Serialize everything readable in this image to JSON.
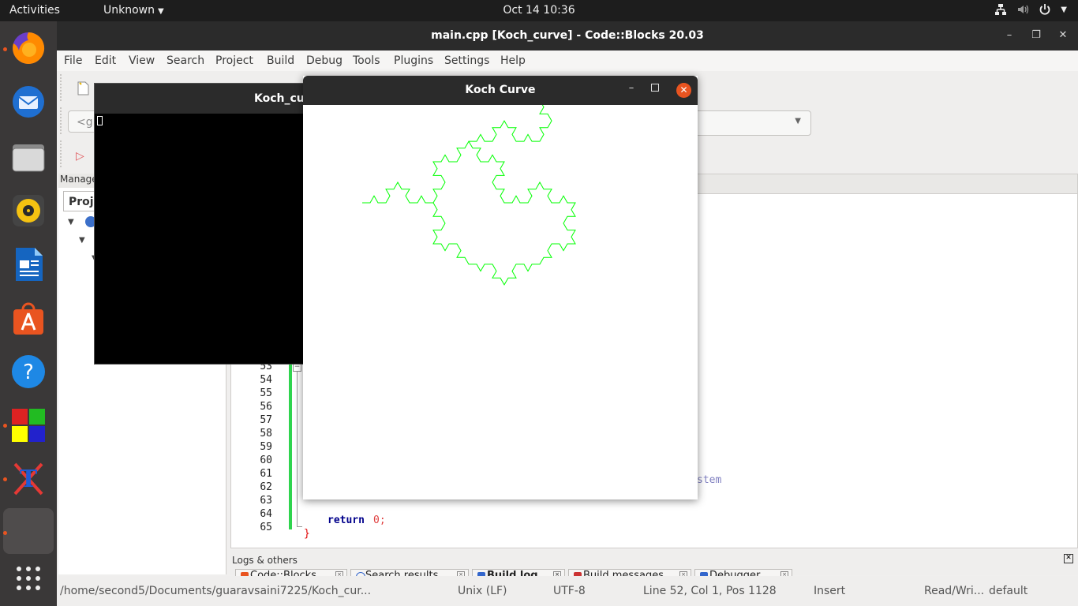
{
  "topbar": {
    "activities": "Activities",
    "app_menu": "Unknown",
    "clock": "Oct 14  10:36"
  },
  "dock": {
    "icons": [
      "firefox-icon",
      "thunderbird-icon",
      "files-icon",
      "rhythmbox-icon",
      "libreoffice-writer-icon",
      "software-center-icon",
      "help-icon",
      "cube-app-icon",
      "xterm-icon",
      "blank-app-icon",
      "show-apps-icon"
    ]
  },
  "codeblocks": {
    "title": "main.cpp [Koch_curve] - Code::Blocks 20.03",
    "menu": [
      "File",
      "Edit",
      "View",
      "Search",
      "Project",
      "Build",
      "Debug",
      "Tools",
      "Plugins",
      "Settings",
      "Help"
    ],
    "scope_combo": "<gl",
    "management_label": "Manage",
    "projects_tab": "Proje",
    "line_numbers": [
      "53",
      "54",
      "55",
      "56",
      "57",
      "58",
      "59",
      "60",
      "61",
      "62",
      "63",
      "64",
      "65"
    ],
    "code_comment_fragment": "stem",
    "return_keyword": "return",
    "return_value": "0;",
    "closing_brace": "}",
    "logs_title": "Logs & others",
    "log_tabs": [
      "Code::Blocks",
      "Search results",
      "Build log",
      "Build messages",
      "Debugger"
    ],
    "status": {
      "path": "/home/second5/Documents/guaravsaini7225/Koch_cur...",
      "line_endings": "Unix (LF)",
      "encoding": "UTF-8",
      "position": "Line 52, Col 1, Pos 1128",
      "mode": "Insert",
      "access": "Read/Wri...",
      "profile": "default"
    }
  },
  "console": {
    "title": "Koch_cur"
  },
  "koch_window": {
    "title": "Koch Curve",
    "curve_color": "#00ff00"
  }
}
